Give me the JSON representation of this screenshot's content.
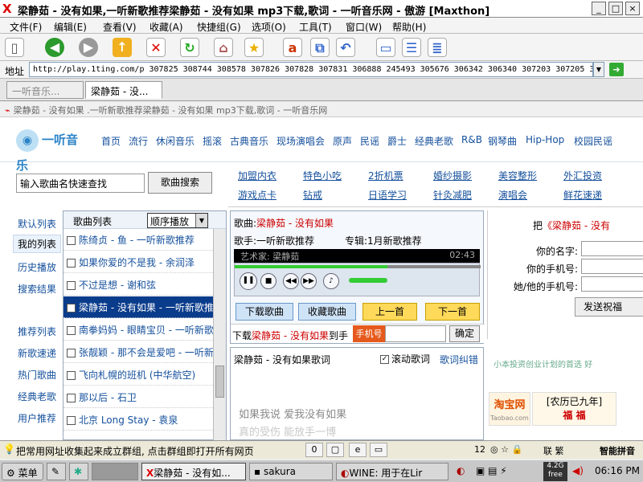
{
  "window": {
    "title": "梁静茹 - 没有如果,一听新歌推荐梁静茹 - 没有如果 mp3下载,歌词 - 一听音乐网 - 傲游 [Maxthon]"
  },
  "menu": [
    "文件(F)",
    "编辑(E)",
    "查看(V)",
    "收藏(A)",
    "快捷组(G)",
    "选项(O)",
    "工具(T)",
    "窗口(W)",
    "帮助(H)"
  ],
  "address": {
    "label": "地址",
    "url": "http://play.1ting.com/p 307825 308744 308578 307826 307828 307831 306888 245493 305676 306342 306340 307203 307205 306211 304"
  },
  "tabs": [
    "一听音乐...",
    "梁静茹 - 没..."
  ],
  "page": {
    "title": "梁静茹 - 没有如果 .一听新歌推荐梁静茹 - 没有如果 mp3下载,歌词 - 一听音乐网",
    "logo": "一听音乐",
    "nav": [
      "首页",
      "流行",
      "休闲音乐",
      "摇滚",
      "古典音乐",
      "现场演唱会",
      "原声",
      "民谣",
      "爵士",
      "经典老歌",
      "R&B",
      "钢琴曲",
      "Hip-Hop",
      "校园民谣"
    ],
    "search_placeholder": "输入歌曲名快速查找",
    "search_button": "歌曲搜索",
    "links": [
      "加盟内衣",
      "特色小吃",
      "2折机票",
      "婚纱摄影",
      "美容整形",
      "外汇投资",
      "游戏点卡",
      "钻戒",
      "日语学习",
      "针灸减肥",
      "演唱会",
      "鲜花速递"
    ],
    "left_menu_top": [
      "默认列表",
      "我的列表",
      "历史播放",
      "搜索结果"
    ],
    "left_menu_bottom": [
      "推荐列表",
      "新歌速递",
      "热门歌曲",
      "经典老歌",
      "用户推荐"
    ],
    "playlist": {
      "header": "歌曲列表",
      "mode": "顺序播放",
      "songs": [
        "陈绮贞 - 鱼 - 一听新歌推荐",
        "如果你爱的不是我 - 余润泽",
        "不过是想 - 谢和弦",
        "梁静茹 - 没有如果 - 一听新歌推荐",
        "南拳妈妈 - 眼睛宝贝 - 一听新歌推荐",
        "张靓颖 - 那不会是爱吧 - 一听新歌推荐",
        "飞向札幌的班机 (中华航空)",
        "那以后 - 石卫",
        "北京 Long Stay - 袁泉"
      ]
    },
    "player": {
      "song_label": "歌曲:",
      "song_name": "梁静茹 - 没有如果",
      "singer_label": "歌手:",
      "singer": "一听新歌推荐",
      "album_label": "专辑:",
      "album": "1月新歌推荐",
      "display_artist": "艺术家: 梁静茹",
      "time": "02:43",
      "progress": 0.62,
      "btn_download": "下载歌曲",
      "btn_collect": "收藏歌曲",
      "btn_prev": "上一首",
      "btn_next": "下一首",
      "dl_prefix": "下载",
      "dl_song": "梁静茹 - 没有如果",
      "dl_to": "到手",
      "phone_label": "手机号",
      "confirm": "确定"
    },
    "lyrics": {
      "header": "梁静茹 - 没有如果歌词",
      "auto_scroll": "滚动歌词",
      "error": "歌词纠错",
      "lines": [
        "如果我说 爱我没有如果",
        "真的受伤 能放手一博"
      ]
    },
    "right_panel": {
      "title_prefix": "把",
      "title_song": "《梁静茹 - 没有",
      "name_label": "你的名字:",
      "phone_label": "你的手机号:",
      "friend_phone_label": "她/他的手机号:",
      "send": "发送祝福"
    },
    "ads": {
      "line": "小本投资创业计划的首选 好",
      "taobao": "淘宝网",
      "taobao_sub": "Taobao.com",
      "anniv": "[农历已九年]"
    }
  },
  "status": {
    "text": "把常用网址收集起来成立群组, 点击群组即打开所有网页",
    "counter": "0",
    "zoom": "12",
    "ime": "智能拼音",
    "ime_extra": "联 繁"
  },
  "taskbar": {
    "start": "菜单",
    "tasks": [
      "梁静茹 - 没有如...",
      "sakura",
      "WINE: 用于在Lir"
    ],
    "mem": "4.2G free",
    "clock": "06:16 PM"
  }
}
